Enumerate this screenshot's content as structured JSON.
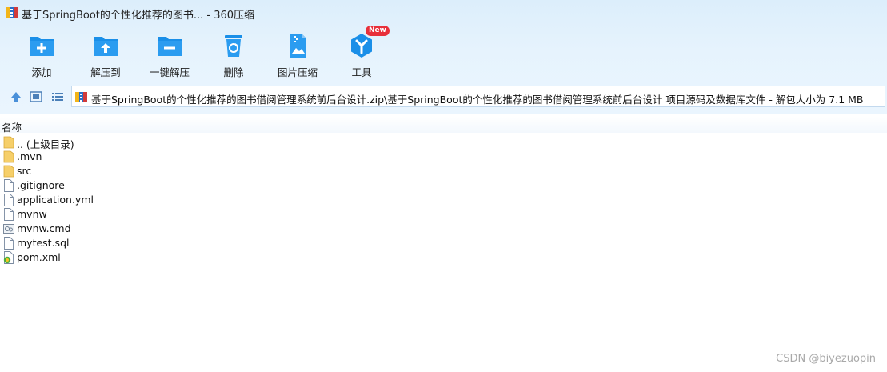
{
  "window": {
    "title": "基于SpringBoot的个性化推荐的图书... - 360压缩",
    "app_icon": "archive-app-icon"
  },
  "toolbar": {
    "buttons": [
      {
        "label": "添加",
        "icon": "add-icon"
      },
      {
        "label": "解压到",
        "icon": "extract-to-icon"
      },
      {
        "label": "一键解压",
        "icon": "one-click-extract-icon"
      },
      {
        "label": "删除",
        "icon": "delete-icon"
      },
      {
        "label": "图片压缩",
        "icon": "image-compress-icon"
      },
      {
        "label": "工具",
        "icon": "tools-icon",
        "badge": "New"
      }
    ],
    "accent_color": "#1a8fe8",
    "badge_color": "#e8303a"
  },
  "nav": {
    "up_icon": "up-arrow-icon",
    "thumbnail_view_icon": "thumbnail-view-icon",
    "list_view_icon": "list-view-icon"
  },
  "address": {
    "text": "基于SpringBoot的个性化推荐的图书借阅管理系统前后台设计.zip\\基于SpringBoot的个性化推荐的图书借阅管理系统前后台设计 项目源码及数据库文件 - 解包大小为 7.1 MB"
  },
  "columns": {
    "name": "名称"
  },
  "files": [
    {
      "name": ".. (上级目录)",
      "type": "folder"
    },
    {
      "name": ".mvn",
      "type": "folder"
    },
    {
      "name": "src",
      "type": "folder"
    },
    {
      "name": ".gitignore",
      "type": "file"
    },
    {
      "name": "application.yml",
      "type": "file"
    },
    {
      "name": "mvnw",
      "type": "file"
    },
    {
      "name": "mvnw.cmd",
      "type": "cmd"
    },
    {
      "name": "mytest.sql",
      "type": "file"
    },
    {
      "name": "pom.xml",
      "type": "xml"
    }
  ],
  "watermark": "CSDN @biyezuopin"
}
